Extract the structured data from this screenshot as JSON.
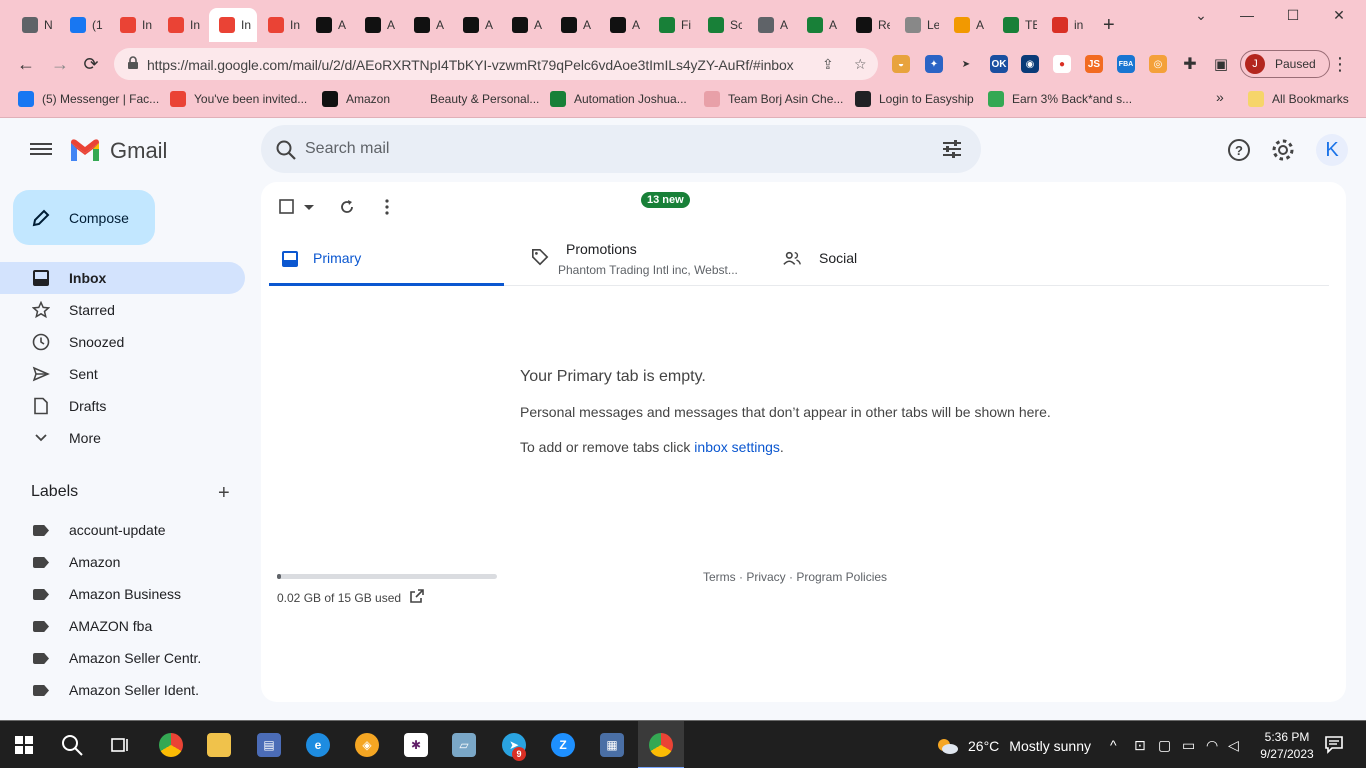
{
  "browser": {
    "tabs": [
      {
        "label": "N",
        "icon": "chrome-icon",
        "color": "#5f6368"
      },
      {
        "label": "(1",
        "icon": "facebook-icon",
        "color": "#1877f2"
      },
      {
        "label": "In",
        "icon": "gmail-icon",
        "color": "#ea4335"
      },
      {
        "label": "In",
        "icon": "gmail-icon",
        "color": "#ea4335"
      },
      {
        "label": "In",
        "icon": "gmail-icon",
        "color": "#ea4335",
        "active": true
      },
      {
        "label": "In",
        "icon": "gmail-icon",
        "color": "#ea4335"
      },
      {
        "label": "A",
        "icon": "amazon-icon",
        "color": "#111111"
      },
      {
        "label": "A",
        "icon": "amazon-icon",
        "color": "#111111"
      },
      {
        "label": "A",
        "icon": "amazon-icon",
        "color": "#111111"
      },
      {
        "label": "A",
        "icon": "amazon-icon",
        "color": "#111111"
      },
      {
        "label": "A",
        "icon": "amazon-icon",
        "color": "#111111"
      },
      {
        "label": "A",
        "icon": "amazon-icon",
        "color": "#111111"
      },
      {
        "label": "A",
        "icon": "amazon-icon",
        "color": "#111111"
      },
      {
        "label": "Fi",
        "icon": "sheets-icon",
        "color": "#188038"
      },
      {
        "label": "Sc",
        "icon": "sheets-icon",
        "color": "#188038"
      },
      {
        "label": "A",
        "icon": "chrome-icon",
        "color": "#5f6368"
      },
      {
        "label": "A",
        "icon": "sheets-icon",
        "color": "#188038"
      },
      {
        "label": "Re",
        "icon": "amazon-icon",
        "color": "#111111"
      },
      {
        "label": "Le",
        "icon": "page-icon",
        "color": "#888888"
      },
      {
        "label": "A",
        "icon": "pencil-icon",
        "color": "#f29900"
      },
      {
        "label": "TE",
        "icon": "sheets-icon",
        "color": "#188038"
      },
      {
        "label": "in",
        "icon": "vivaldi-icon",
        "color": "#d93025"
      }
    ],
    "url": "https://mail.google.com/mail/u/2/d/AEoRXRTNpI4TbKYI-vzwmRt79qPelc6vdAoe3tImILs4yZY-AuRf/#inbox",
    "profile_initial": "J",
    "profile_status": "Paused",
    "bookmarks": [
      {
        "label": "(5) Messenger | Fac...",
        "icon": "facebook-icon",
        "color": "#1877f2"
      },
      {
        "label": "You've been invited...",
        "icon": "gmail-icon",
        "color": "#ea4335"
      },
      {
        "label": "Amazon",
        "icon": "amazon-icon",
        "color": "#111111"
      },
      {
        "label": "Beauty & Personal...",
        "icon": "amazon-smile-icon",
        "color": "#f8c8d0"
      },
      {
        "label": "Automation Joshua...",
        "icon": "sheets-icon",
        "color": "#188038"
      },
      {
        "label": "Team Borj Asin Che...",
        "icon": "logo-icon",
        "color": "#e8a0a8"
      },
      {
        "label": "Login to Easyship",
        "icon": "easyship-icon",
        "color": "#202124"
      },
      {
        "label": "Earn 3% Back*and s...",
        "icon": "cashback-icon",
        "color": "#34a853"
      }
    ],
    "all_bookmarks": "All Bookmarks"
  },
  "gmail": {
    "title": "Gmail",
    "search_placeholder": "Search mail",
    "account_initial": "K",
    "compose": "Compose",
    "nav": [
      {
        "label": "Inbox",
        "icon": "inbox-icon",
        "active": true
      },
      {
        "label": "Starred",
        "icon": "star-icon"
      },
      {
        "label": "Snoozed",
        "icon": "clock-icon"
      },
      {
        "label": "Sent",
        "icon": "send-icon"
      },
      {
        "label": "Drafts",
        "icon": "draft-icon"
      },
      {
        "label": "More",
        "icon": "chevron-down-icon"
      }
    ],
    "labels_heading": "Labels",
    "labels": [
      "account-update",
      "Amazon",
      "Amazon Business",
      "AMAZON fba",
      "Amazon Seller Centr.",
      "Amazon Seller Ident."
    ],
    "tabs": {
      "primary": "Primary",
      "promotions": "Promotions",
      "promotions_badge": "13 new",
      "promotions_sub": "Phantom Trading Intl inc, Webst...",
      "social": "Social"
    },
    "empty": {
      "title": "Your Primary tab is empty.",
      "desc": "Personal messages and messages that don’t appear in other tabs will be shown here.",
      "hint_prefix": "To add or remove tabs click ",
      "hint_link": "inbox settings",
      "hint_suffix": "."
    },
    "storage": {
      "text": "0.02 GB of 15 GB used",
      "used_fraction": 0.0013
    },
    "footer": "Terms · Privacy · Program Policies"
  },
  "taskbar": {
    "temperature": "26°C",
    "condition": "Mostly sunny",
    "time": "5:36 PM",
    "date": "9/27/2023",
    "telegram_badge": "9"
  }
}
